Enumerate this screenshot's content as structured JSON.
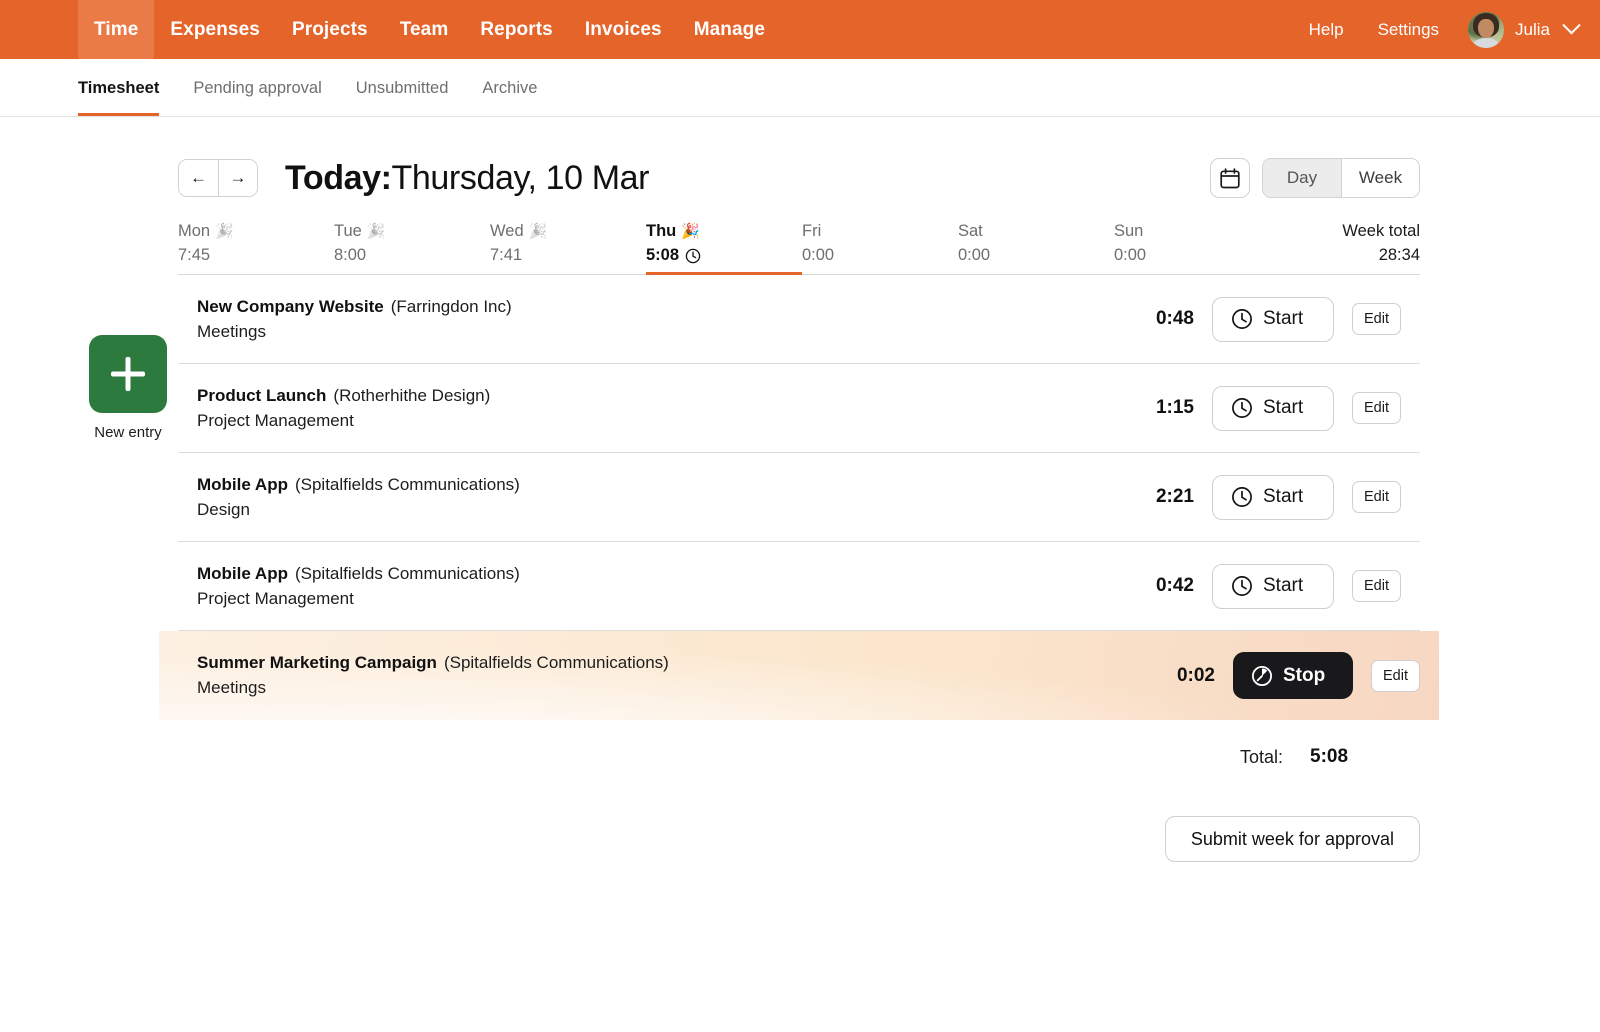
{
  "topnav": {
    "items": [
      {
        "label": "Time",
        "active": true
      },
      {
        "label": "Expenses",
        "active": false
      },
      {
        "label": "Projects",
        "active": false
      },
      {
        "label": "Team",
        "active": false
      },
      {
        "label": "Reports",
        "active": false
      },
      {
        "label": "Invoices",
        "active": false
      },
      {
        "label": "Manage",
        "active": false
      }
    ],
    "help": "Help",
    "settings": "Settings",
    "user_name": "Julia",
    "brand_color": "#E5642A",
    "active_tab_color": "#EA7A46"
  },
  "subnav": {
    "tabs": [
      {
        "label": "Timesheet",
        "active": true
      },
      {
        "label": "Pending approval",
        "active": false
      },
      {
        "label": "Unsubmitted",
        "active": false
      },
      {
        "label": "Archive",
        "active": false
      }
    ]
  },
  "header": {
    "prev_label": "←",
    "next_label": "→",
    "title_prefix": "Today:",
    "title_date": "Thursday, 10 Mar",
    "view_day": "Day",
    "view_week": "Week",
    "view_selected": "Day"
  },
  "new_entry": {
    "label": "New entry",
    "color": "#2C7A3D"
  },
  "week": {
    "days": [
      {
        "name": "Mon",
        "hours": "7:45",
        "emoji": "🎉",
        "emoji_dim": true,
        "today": false,
        "has_clock": false
      },
      {
        "name": "Tue",
        "hours": "8:00",
        "emoji": "🎉",
        "emoji_dim": true,
        "today": false,
        "has_clock": false
      },
      {
        "name": "Wed",
        "hours": "7:41",
        "emoji": "🎉",
        "emoji_dim": true,
        "today": false,
        "has_clock": false
      },
      {
        "name": "Thu",
        "hours": "5:08",
        "emoji": "🎉",
        "emoji_dim": false,
        "today": true,
        "has_clock": true
      },
      {
        "name": "Fri",
        "hours": "0:00",
        "emoji": "",
        "emoji_dim": false,
        "today": false,
        "has_clock": false
      },
      {
        "name": "Sat",
        "hours": "0:00",
        "emoji": "",
        "emoji_dim": false,
        "today": false,
        "has_clock": false
      },
      {
        "name": "Sun",
        "hours": "0:00",
        "emoji": "",
        "emoji_dim": false,
        "today": false,
        "has_clock": false
      }
    ],
    "total_label": "Week total",
    "total_value": "28:34"
  },
  "entries": [
    {
      "project": "New Company Website",
      "client": "(Farringdon Inc)",
      "task": "Meetings",
      "duration": "0:48",
      "action": "Start",
      "edit": "Edit",
      "running": false
    },
    {
      "project": "Product Launch",
      "client": "(Rotherhithe Design)",
      "task": "Project Management",
      "duration": "1:15",
      "action": "Start",
      "edit": "Edit",
      "running": false
    },
    {
      "project": "Mobile App",
      "client": "(Spitalfields Communications)",
      "task": "Design",
      "duration": "2:21",
      "action": "Start",
      "edit": "Edit",
      "running": false
    },
    {
      "project": "Mobile App",
      "client": "(Spitalfields Communications)",
      "task": "Project Management",
      "duration": "0:42",
      "action": "Start",
      "edit": "Edit",
      "running": false
    },
    {
      "project": "Summer Marketing Campaign",
      "client": "(Spitalfields Communications)",
      "task": "Meetings",
      "duration": "0:02",
      "action": "Stop",
      "edit": "Edit",
      "running": true
    }
  ],
  "footer": {
    "total_label": "Total:",
    "total_value": "5:08",
    "submit_label": "Submit week for approval"
  }
}
